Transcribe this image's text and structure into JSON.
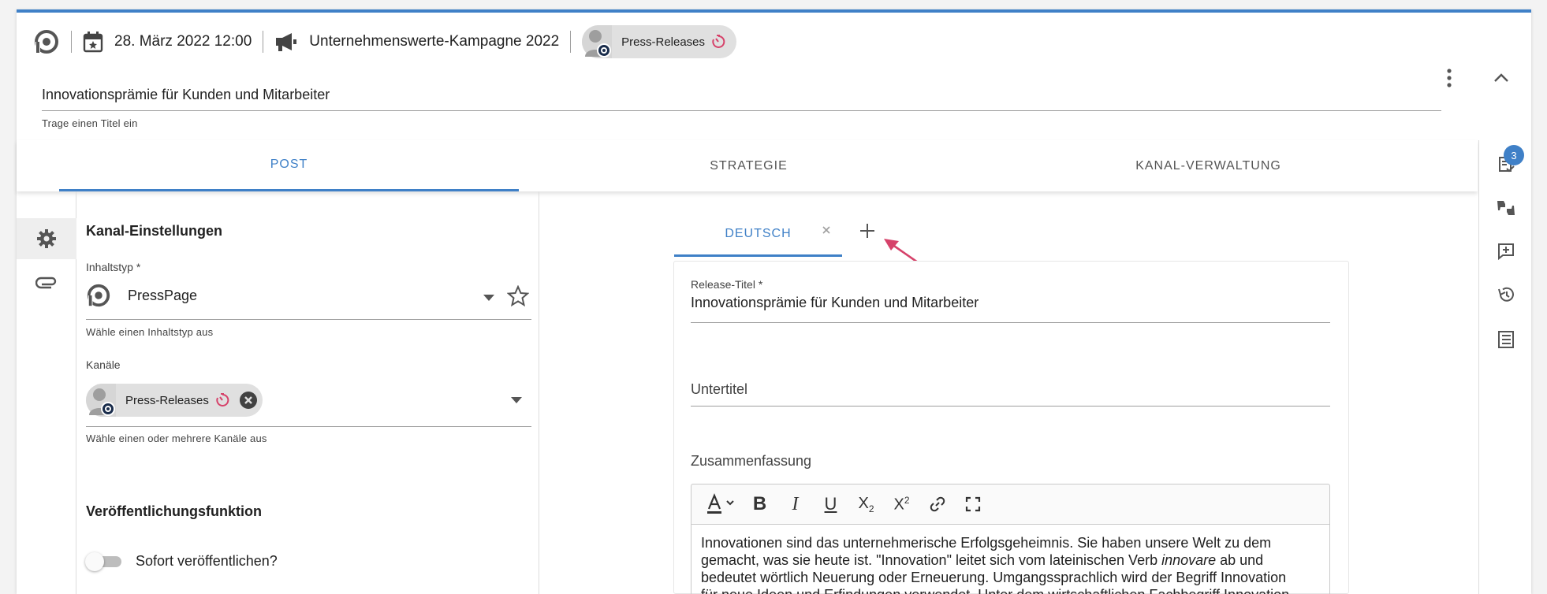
{
  "header": {
    "date": "28. März 2022 12:00",
    "campaign": "Unternehmenswerte-Kampagne 2022",
    "channel_chip": "Press-Releases",
    "title_value": "Innovationsprämie für Kunden und Mitarbeiter",
    "title_helper": "Trage einen Titel ein"
  },
  "tabs": [
    {
      "label": "POST"
    },
    {
      "label": "STRATEGIE"
    },
    {
      "label": "KANAL-VERWALTUNG"
    }
  ],
  "right_rail": {
    "tasks_count": "3"
  },
  "settings": {
    "heading": "Kanal-Einstellungen",
    "content_type_label": "Inhaltstyp *",
    "content_type_value": "PressPage",
    "content_type_helper": "Wähle einen Inhaltstyp aus",
    "channels_label": "Kanäle",
    "channel_chip": "Press-Releases",
    "channels_helper": "Wähle einen oder mehrere Kanäle aus",
    "publish_heading": "Veröffentlichungsfunktion",
    "publish_toggle_label": "Sofort veröffentlichen?"
  },
  "editor": {
    "language_tab": "DEUTSCH",
    "release_title_label": "Release-Titel *",
    "release_title_value": "Innovationsprämie für Kunden und Mitarbeiter",
    "subtitle_placeholder": "Untertitel",
    "summary_label": "Zusammenfassung",
    "summary_line1": "Innovationen sind das unternehmerische Erfolgsgeheimnis. Sie haben unsere Welt zu dem",
    "summary_line2a": "gemacht, was sie heute ist. \"Innovation\" leitet sich vom lateinischen Verb ",
    "summary_line2_italic": "innovare",
    "summary_line2b": " ab und",
    "summary_line3": "bedeutet wörtlich Neuerung oder Erneuerung. Umgangssprachlich wird der Begriff Innovation",
    "summary_line4": "für neue Ideen und Erfindungen verwendet. Unter dem wirtschaftlichen Fachbegriff Innovation"
  },
  "colors": {
    "accent": "#3f80c7",
    "arrow": "#d6426a",
    "timer": "#d6426a"
  }
}
